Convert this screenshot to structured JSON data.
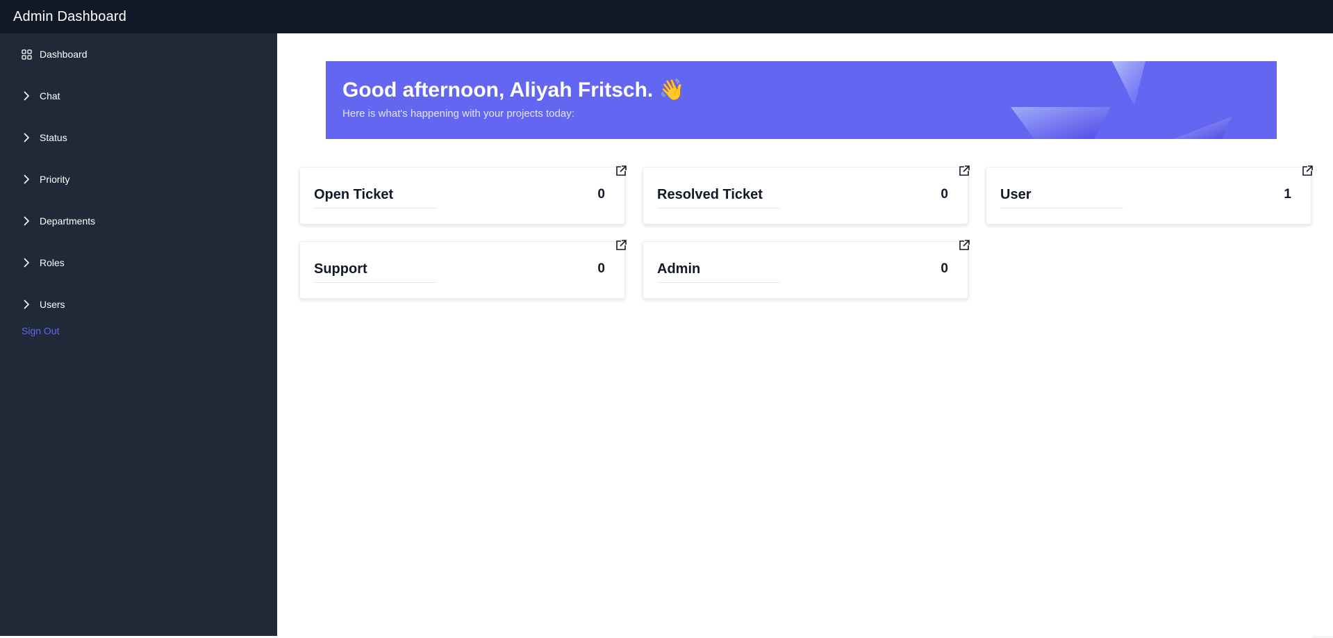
{
  "app": {
    "title": "Admin Dashboard"
  },
  "sidebar": {
    "items": [
      {
        "label": "Dashboard",
        "icon": "grid-icon"
      },
      {
        "label": "Chat",
        "icon": "chevron-right-icon"
      },
      {
        "label": "Status",
        "icon": "chevron-right-icon"
      },
      {
        "label": "Priority",
        "icon": "chevron-right-icon"
      },
      {
        "label": "Departments",
        "icon": "chevron-right-icon"
      },
      {
        "label": "Roles",
        "icon": "chevron-right-icon"
      },
      {
        "label": "Users",
        "icon": "chevron-right-icon"
      }
    ],
    "sign_out": "Sign Out"
  },
  "banner": {
    "greeting": "Good afternoon, Aliyah Fritsch. 👋",
    "subtitle": "Here is what's happening with your projects today:"
  },
  "cards": [
    {
      "title": "Open Ticket",
      "count": "0"
    },
    {
      "title": "Resolved Ticket",
      "count": "0"
    },
    {
      "title": "User",
      "count": "1"
    },
    {
      "title": "Support",
      "count": "0"
    },
    {
      "title": "Admin",
      "count": "0"
    }
  ],
  "colors": {
    "topbar": "#111827",
    "sidebar": "#1f2937",
    "accent": "#6366f1",
    "text_dark": "#111827"
  }
}
